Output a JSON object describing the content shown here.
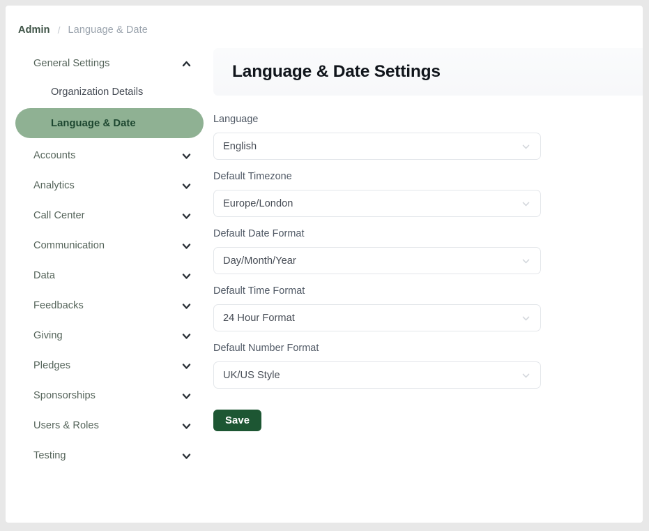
{
  "breadcrumb": {
    "root": "Admin",
    "separator": "/",
    "current": "Language & Date"
  },
  "sidebar": {
    "items": [
      {
        "label": "General Settings",
        "type": "group",
        "icon": "chevron-up-icon",
        "expanded": true
      },
      {
        "label": "Organization Details",
        "type": "sub",
        "icon": "none"
      },
      {
        "label": "Language & Date",
        "type": "sub-active",
        "icon": "none",
        "active": true
      },
      {
        "label": "Accounts",
        "type": "group",
        "icon": "chevron-down-icon"
      },
      {
        "label": "Analytics",
        "type": "group",
        "icon": "chevron-down-icon"
      },
      {
        "label": "Call Center",
        "type": "group",
        "icon": "chevron-down-icon"
      },
      {
        "label": "Communication",
        "type": "group",
        "icon": "chevron-down-icon"
      },
      {
        "label": "Data",
        "type": "group",
        "icon": "chevron-down-icon"
      },
      {
        "label": "Feedbacks",
        "type": "group",
        "icon": "chevron-down-icon"
      },
      {
        "label": "Giving",
        "type": "group",
        "icon": "chevron-down-icon"
      },
      {
        "label": "Pledges",
        "type": "group",
        "icon": "chevron-down-icon"
      },
      {
        "label": "Sponsorships",
        "type": "group",
        "icon": "chevron-down-icon"
      },
      {
        "label": "Users & Roles",
        "type": "group",
        "icon": "chevron-down-icon"
      },
      {
        "label": "Testing",
        "type": "group",
        "icon": "chevron-down-icon"
      }
    ]
  },
  "panel": {
    "title": "Language & Date Settings"
  },
  "form": {
    "fields": [
      {
        "label": "Language",
        "value": "English",
        "icon": "chevron-down-icon"
      },
      {
        "label": "Default Timezone",
        "value": "Europe/London",
        "icon": "chevron-down-icon"
      },
      {
        "label": "Default Date Format",
        "value": "Day/Month/Year",
        "icon": "chevron-down-icon"
      },
      {
        "label": "Default Time Format",
        "value": "24 Hour Format",
        "icon": "chevron-down-icon"
      },
      {
        "label": "Default Number Format",
        "value": "UK/US Style",
        "icon": "chevron-down-icon"
      }
    ],
    "save_label": "Save"
  },
  "colors": {
    "accent_green": "#1d5633",
    "active_nav_bg": "#8fb193",
    "active_nav_text": "#1d4730",
    "page_bg": "#e8e8e8",
    "card_bg": "#ffffff",
    "panel_header_bg": "#f7f8fa",
    "border": "#e3e6ea"
  }
}
